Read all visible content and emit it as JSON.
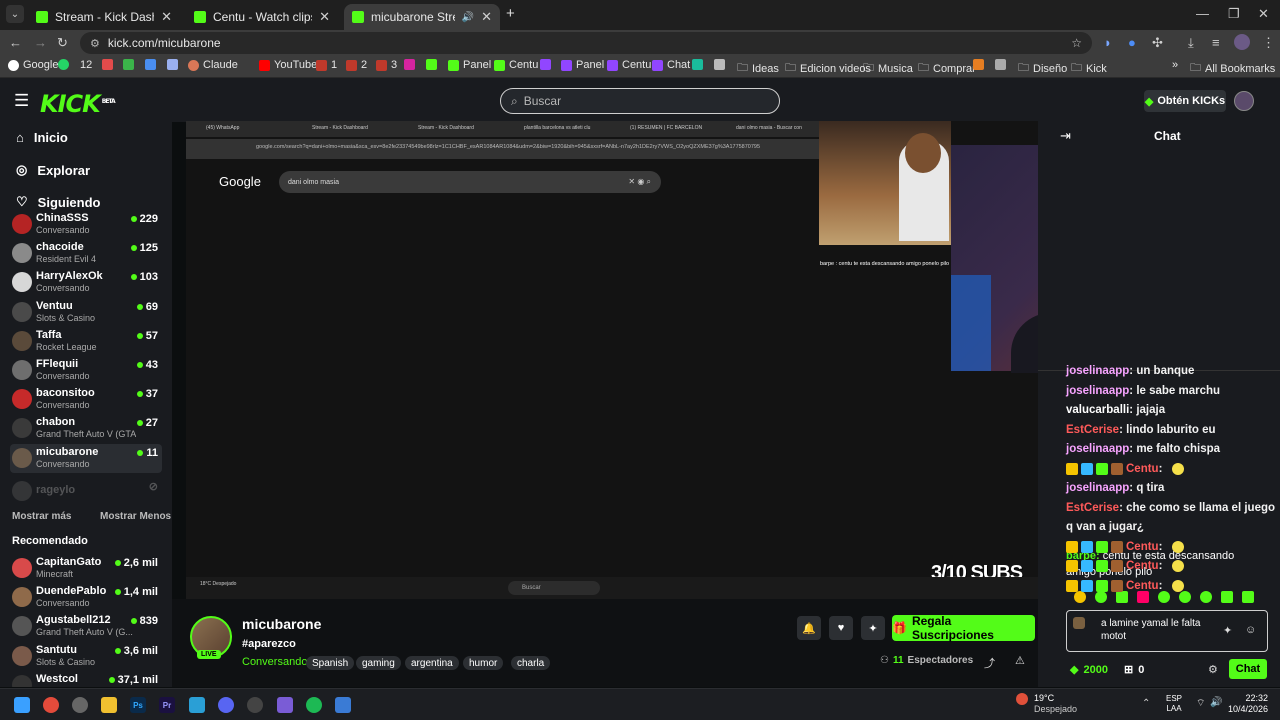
{
  "browser": {
    "tabs": [
      {
        "title": "Stream - Kick Dashboard",
        "active": false
      },
      {
        "title": "Centu - Watch clips on Kick",
        "active": false
      },
      {
        "title": "micubarone Stream - Watc",
        "active": true
      }
    ],
    "new_tab_label": "+",
    "url": "kick.com/micubarone",
    "bookmarks": [
      "Google",
      "12",
      "Claude",
      "YouTube",
      "1",
      "2",
      "3",
      "Panel",
      "Centu",
      "Panel",
      "Centu",
      "Chat",
      "Ideas",
      "Edicion videos",
      "Musica",
      "Comprar",
      "Diseño",
      "Kick"
    ],
    "all_bookmarks_label": "All Bookmarks"
  },
  "header": {
    "logo_text": "KICK",
    "logo_beta": "BETA",
    "search_placeholder": "Buscar",
    "get_kicks_label": "Obtén KICKs"
  },
  "sidebar": {
    "nav": [
      {
        "label": "Inicio",
        "icon": "home-icon"
      },
      {
        "label": "Explorar",
        "icon": "compass-icon"
      },
      {
        "label": "Siguiendo",
        "icon": "heart-icon"
      }
    ],
    "following": [
      {
        "name": "ChinaSSS",
        "game": "Conversando",
        "viewers": "229",
        "avatar_color": "#b52424"
      },
      {
        "name": "chacoide",
        "game": "Resident Evil 4",
        "viewers": "125",
        "avatar_color": "#8a8a8a"
      },
      {
        "name": "HarryAlexOk",
        "game": "Conversando",
        "viewers": "103",
        "avatar_color": "#d7d7d7"
      },
      {
        "name": "Ventuu",
        "game": "Slots & Casino",
        "viewers": "69",
        "avatar_color": "#4a4a4a"
      },
      {
        "name": "Taffa",
        "game": "Rocket League",
        "viewers": "57",
        "avatar_color": "#5a4a3a"
      },
      {
        "name": "FFlequii",
        "game": "Conversando",
        "viewers": "43",
        "avatar_color": "#6e6e6e"
      },
      {
        "name": "baconsitoo",
        "game": "Conversando",
        "viewers": "37",
        "avatar_color": "#c62a2a"
      },
      {
        "name": "chabon",
        "game": "Grand Theft Auto V (GTA)",
        "viewers": "27",
        "avatar_color": "#3a3a3a"
      },
      {
        "name": "micubarone",
        "game": "Conversando",
        "viewers": "11",
        "avatar_color": "#6a5a4a"
      }
    ],
    "offline": {
      "name": "rageylo"
    },
    "show_more": "Mostrar más",
    "show_less": "Mostrar Menos",
    "recommended_title": "Recomendado",
    "recommended": [
      {
        "name": "CapitanGato",
        "game": "Minecraft",
        "viewers": "2,6 mil",
        "avatar_color": "#d84a4a"
      },
      {
        "name": "DuendePablo",
        "game": "Conversando",
        "viewers": "1,4 mil",
        "avatar_color": "#8f6a4a"
      },
      {
        "name": "Agustabell212",
        "game": "Grand Theft Auto V (G...",
        "viewers": "839",
        "avatar_color": "#555"
      },
      {
        "name": "Santutu",
        "game": "Slots & Casino",
        "viewers": "3,6 mil",
        "avatar_color": "#7a5a4a"
      },
      {
        "name": "Westcol",
        "game": "",
        "viewers": "37,1 mil",
        "avatar_color": "#333"
      }
    ]
  },
  "stream": {
    "inner_tabs": [
      "(45) WhatsApp",
      "Stream - Kick Dashboard",
      "Stream - Kick Dashboard",
      "plantilla barcelona vs atleti clu",
      "(1) RESUMEN | FC BARCELON",
      "dani olmo masia - Buscar con"
    ],
    "inner_url": "google.com/search?q=dani+olmo+masia&sca_esv=8e2fe23374549be98rlz=1C1CHBF_esAR1084AR1084&udm=2&biw=1920&bih=945&sxsrf=ANbL-n7ay2h1DE2ry7VWS_O2yoQZXME37g%3A1775870795",
    "google_label": "Google",
    "google_query": "dani olmo masia",
    "subs_goal": "3/10 SUBS",
    "webcam_chat": "barpe : centu te esta descansando amigo ponelo pilo",
    "inner_taskbar_search": "Buscar",
    "inner_weather": "18°C Despejado"
  },
  "channel": {
    "name": "micubarone",
    "live_label": "LIVE",
    "title": "#aparezco",
    "category": "Conversando",
    "tags": [
      "Spanish",
      "gaming",
      "argentina",
      "humor",
      "charla"
    ],
    "gift_label": "Regala Suscripciones",
    "viewers_count": "11",
    "viewers_label": "Espectadores"
  },
  "chat": {
    "title": "Chat",
    "messages": [
      {
        "user": "joselinaapp",
        "text": "un banque",
        "color": "#f7a4ff"
      },
      {
        "user": "joselinaapp",
        "text": "le sabe marchu",
        "color": "#f7a4ff"
      },
      {
        "user": "valucarballi",
        "text": "jajaja",
        "color": "#ffffff"
      },
      {
        "user": "EstCerise",
        "text": "lindo laburito eu",
        "color": "#ff5a5a"
      },
      {
        "user": "joselinaapp",
        "text": "me falto chispa",
        "color": "#f7a4ff"
      },
      {
        "user": "Centu",
        "text": "",
        "color": "#ff5a5a"
      },
      {
        "user": "joselinaapp",
        "text": "q tira",
        "color": "#f7a4ff"
      },
      {
        "user": "EstCerise",
        "text": "che como se llama el juego",
        "color": "#ff5a5a"
      },
      {
        "user": "",
        "text": "q van a jugar¿",
        "color": "#ffffff"
      },
      {
        "user": "Centu",
        "text": "",
        "color": "#ff5a5a"
      },
      {
        "user": "Centu",
        "text": "",
        "color": "#ff5a5a"
      },
      {
        "user": "Centu",
        "text": "",
        "color": "#ff5a5a"
      }
    ],
    "last_user": "barpe",
    "last_text_1": "centu te esta descansando",
    "last_text_2": "amigo ponelo pilo",
    "input_line_1": "a lamine yamal le falta",
    "input_line_2": "motot",
    "kicks_count": "2000",
    "subs_count": "0",
    "send_label": "Chat"
  },
  "taskbar": {
    "weather_temp": "19°C",
    "weather_desc": "Despejado",
    "lang_1": "ESP",
    "lang_2": "LAA",
    "time": "22:32",
    "date": "10/4/2026"
  }
}
